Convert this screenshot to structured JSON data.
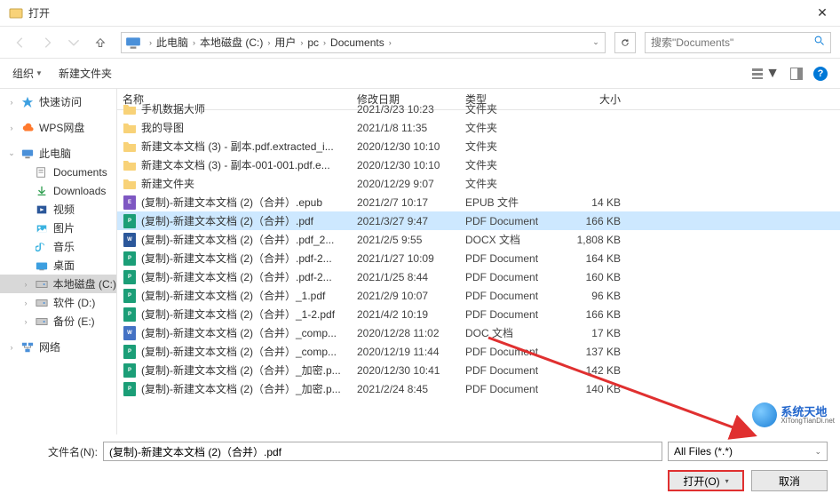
{
  "window": {
    "title": "打开",
    "close": "✕"
  },
  "nav": {
    "crumbs": [
      "此电脑",
      "本地磁盘 (C:)",
      "用户",
      "pc",
      "Documents"
    ],
    "search_placeholder": "搜索\"Documents\""
  },
  "toolbar": {
    "organize": "组织",
    "newfolder": "新建文件夹"
  },
  "sidebar": {
    "quick": "快速访问",
    "wps": "WPS网盘",
    "thispc": "此电脑",
    "pc_children": [
      {
        "label": "Documents"
      },
      {
        "label": "Downloads"
      },
      {
        "label": "视频"
      },
      {
        "label": "图片"
      },
      {
        "label": "音乐"
      },
      {
        "label": "桌面"
      },
      {
        "label": "本地磁盘 (C:)",
        "sel": true
      },
      {
        "label": "软件 (D:)"
      },
      {
        "label": "备份 (E:)"
      }
    ],
    "network": "网络"
  },
  "columns": {
    "name": "名称",
    "date": "修改日期",
    "type": "类型",
    "size": "大小"
  },
  "files": [
    {
      "icon": "folder",
      "name": "手机数据大师",
      "date": "2021/3/23 10:23",
      "type": "文件夹",
      "size": ""
    },
    {
      "icon": "folder",
      "name": "我的导图",
      "date": "2021/1/8 11:35",
      "type": "文件夹",
      "size": ""
    },
    {
      "icon": "folder",
      "name": "新建文本文档 (3) - 副本.pdf.extracted_i...",
      "date": "2020/12/30 10:10",
      "type": "文件夹",
      "size": ""
    },
    {
      "icon": "folder",
      "name": "新建文本文档 (3) - 副本-001-001.pdf.e...",
      "date": "2020/12/30 10:10",
      "type": "文件夹",
      "size": ""
    },
    {
      "icon": "folder",
      "name": "新建文件夹",
      "date": "2020/12/29 9:07",
      "type": "文件夹",
      "size": ""
    },
    {
      "icon": "epub",
      "name": "(复制)-新建文本文档 (2)（合并）.epub",
      "date": "2021/2/7 10:17",
      "type": "EPUB 文件",
      "size": "14 KB"
    },
    {
      "icon": "pdf",
      "name": "(复制)-新建文本文档 (2)（合并）.pdf",
      "date": "2021/3/27 9:47",
      "type": "PDF Document",
      "size": "166 KB",
      "selected": true
    },
    {
      "icon": "docx",
      "name": "(复制)-新建文本文档 (2)（合并）.pdf_2...",
      "date": "2021/2/5 9:55",
      "type": "DOCX 文档",
      "size": "1,808 KB"
    },
    {
      "icon": "pdf",
      "name": "(复制)-新建文本文档 (2)（合并）.pdf-2...",
      "date": "2021/1/27 10:09",
      "type": "PDF Document",
      "size": "164 KB"
    },
    {
      "icon": "pdf",
      "name": "(复制)-新建文本文档 (2)（合并）.pdf-2...",
      "date": "2021/1/25 8:44",
      "type": "PDF Document",
      "size": "160 KB"
    },
    {
      "icon": "pdf",
      "name": "(复制)-新建文本文档 (2)（合并）_1.pdf",
      "date": "2021/2/9 10:07",
      "type": "PDF Document",
      "size": "96 KB"
    },
    {
      "icon": "pdf",
      "name": "(复制)-新建文本文档 (2)（合并）_1-2.pdf",
      "date": "2021/4/2 10:19",
      "type": "PDF Document",
      "size": "166 KB"
    },
    {
      "icon": "doc",
      "name": "(复制)-新建文本文档 (2)（合并）_comp...",
      "date": "2020/12/28 11:02",
      "type": "DOC 文档",
      "size": "17 KB"
    },
    {
      "icon": "pdf",
      "name": "(复制)-新建文本文档 (2)（合并）_comp...",
      "date": "2020/12/19 11:44",
      "type": "PDF Document",
      "size": "137 KB"
    },
    {
      "icon": "pdf",
      "name": "(复制)-新建文本文档 (2)（合并）_加密.p...",
      "date": "2020/12/30 10:41",
      "type": "PDF Document",
      "size": "142 KB"
    },
    {
      "icon": "pdf",
      "name": "(复制)-新建文本文档 (2)（合并）_加密.p...",
      "date": "2021/2/24 8:45",
      "type": "PDF Document",
      "size": "140 KB"
    }
  ],
  "footer": {
    "fname_label": "文件名(N):",
    "fname_value": "(复制)-新建文本文档 (2)（合并）.pdf",
    "filter": "All Files (*.*)",
    "open": "打开(O)",
    "cancel": "取消"
  },
  "watermark": {
    "cn": "系统天地",
    "en": "XiTongTianDi.net"
  }
}
